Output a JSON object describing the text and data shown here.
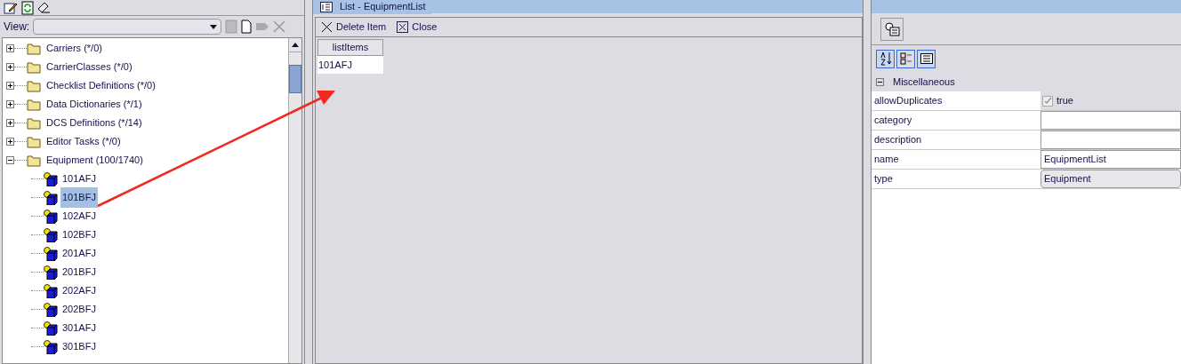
{
  "view": {
    "label": "View:"
  },
  "tree": [
    {
      "label": "Carriers (*/0)",
      "expanded": false
    },
    {
      "label": "CarrierClasses (*/0)",
      "expanded": false
    },
    {
      "label": "Checklist Definitions (*/0)",
      "expanded": false
    },
    {
      "label": "Data Dictionaries (*/1)",
      "expanded": false
    },
    {
      "label": "DCS Definitions (*/14)",
      "expanded": false
    },
    {
      "label": "Editor Tasks (*/0)",
      "expanded": false
    },
    {
      "label": "Equipment (100/1740)",
      "expanded": true,
      "children": [
        {
          "label": "101AFJ",
          "selected": false
        },
        {
          "label": "101BFJ",
          "selected": true
        },
        {
          "label": "102AFJ",
          "selected": false
        },
        {
          "label": "102BFJ",
          "selected": false
        },
        {
          "label": "201AFJ",
          "selected": false
        },
        {
          "label": "201BFJ",
          "selected": false
        },
        {
          "label": "202AFJ",
          "selected": false
        },
        {
          "label": "202BFJ",
          "selected": false
        },
        {
          "label": "301AFJ",
          "selected": false
        },
        {
          "label": "301BFJ",
          "selected": false
        }
      ]
    }
  ],
  "document": {
    "title": "List - EquipmentList",
    "toolbar": [
      {
        "kind": "delete",
        "label": "Delete Item"
      },
      {
        "kind": "close",
        "label": "Close"
      }
    ],
    "table": {
      "columns": [
        "listItems"
      ],
      "rows": [
        [
          "101AFJ"
        ]
      ]
    }
  },
  "properties": {
    "category": {
      "label": "Miscellaneous",
      "expanded": true
    },
    "rows": [
      {
        "name": "allowDuplicates",
        "kind": "checkbox",
        "checked": true,
        "value": "true"
      },
      {
        "name": "category",
        "kind": "text"
      },
      {
        "name": "description",
        "kind": "text"
      },
      {
        "name": "name",
        "kind": "text",
        "value": "EquipmentList"
      },
      {
        "name": "type",
        "kind": "combo",
        "value": "Equipment"
      }
    ]
  }
}
